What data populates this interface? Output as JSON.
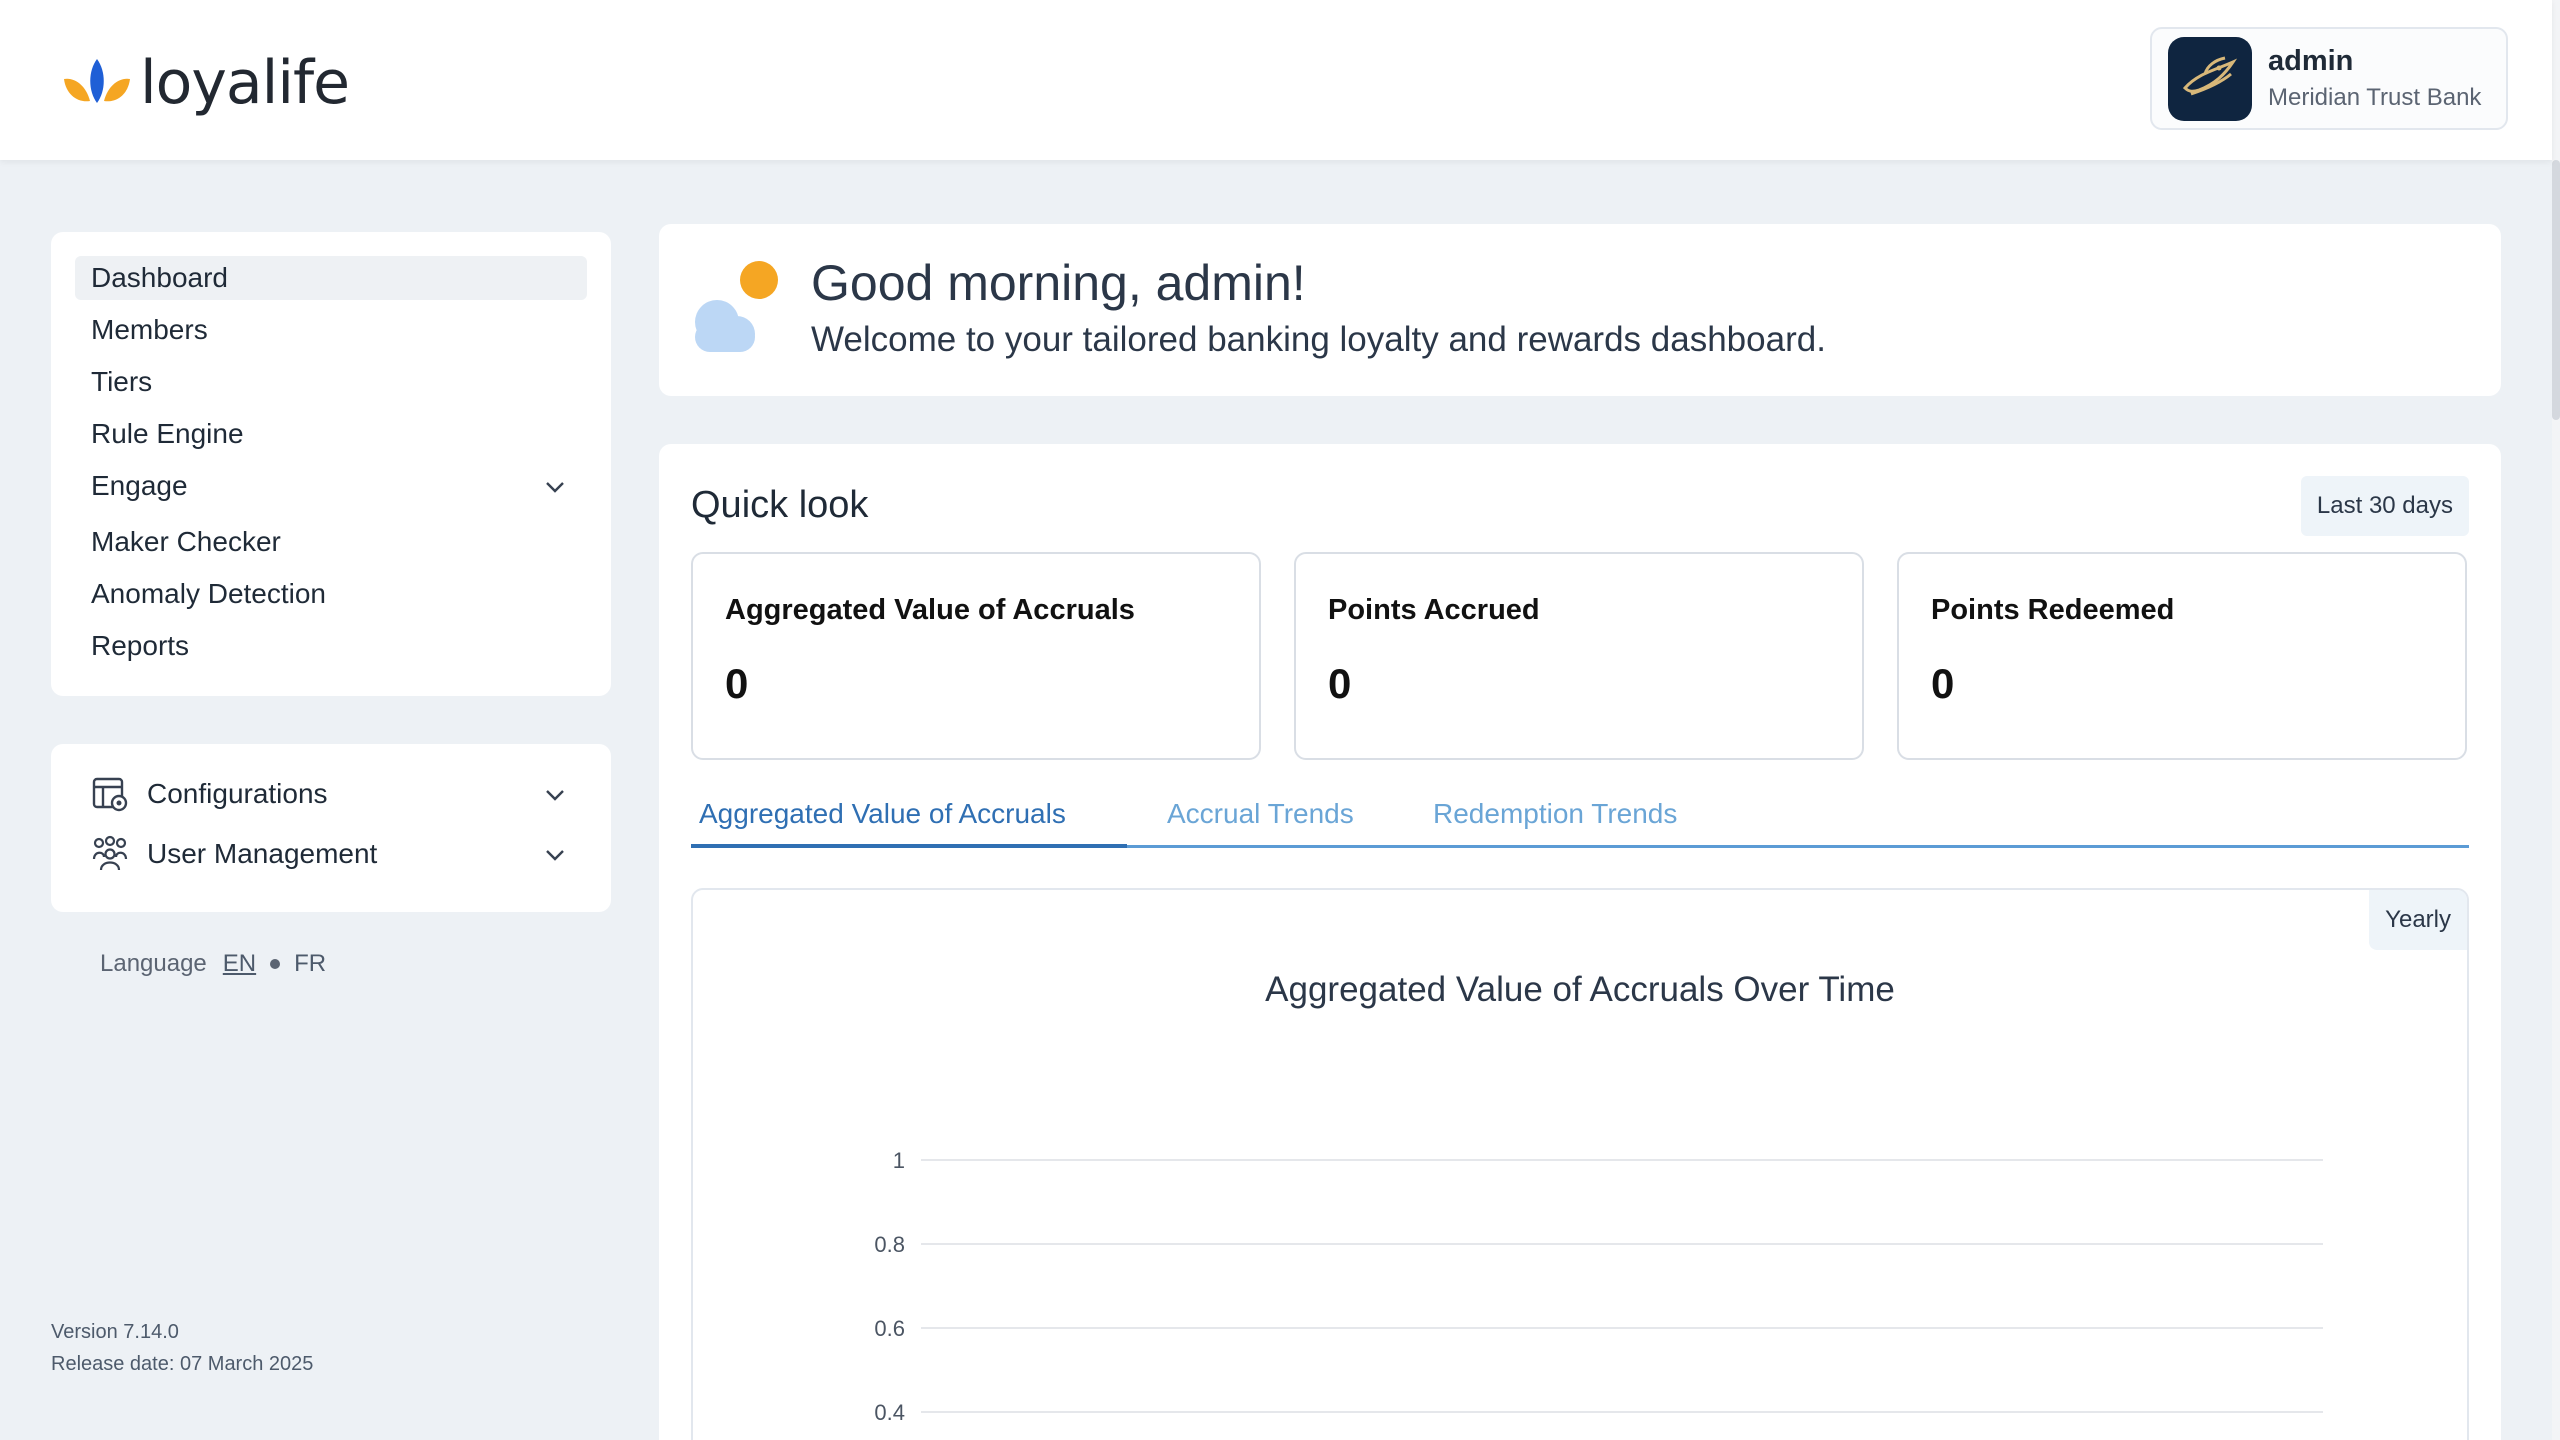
{
  "brand": {
    "name": "loyalife",
    "colors": {
      "leaf_left": "#f5a623",
      "leaf_center": "#1f5fd6",
      "leaf_right": "#f5a623"
    }
  },
  "profile": {
    "name": "admin",
    "org": "Meridian Trust Bank",
    "avatar_icon": "bird-logo-icon"
  },
  "sidebar": {
    "items": [
      {
        "label": "Dashboard",
        "active": true
      },
      {
        "label": "Members"
      },
      {
        "label": "Tiers"
      },
      {
        "label": "Rule Engine"
      },
      {
        "label": "Engage",
        "expandable": true
      },
      {
        "label": "Maker Checker"
      },
      {
        "label": "Anomaly Detection"
      },
      {
        "label": "Reports"
      }
    ],
    "config": [
      {
        "label": "Configurations",
        "icon": "settings-table-icon"
      },
      {
        "label": "User Management",
        "icon": "users-group-icon"
      }
    ],
    "language": {
      "label": "Language",
      "options": [
        "EN",
        "FR"
      ],
      "selected": "EN"
    },
    "version": "Version 7.14.0",
    "release": "Release date: 07 March 2025"
  },
  "greeting": {
    "title": "Good morning, admin!",
    "subtitle": "Welcome to your tailored banking loyalty and rewards dashboard.",
    "icon": "sun-cloud-icon"
  },
  "quick_look": {
    "title": "Quick look",
    "range": "Last 30 days",
    "stats": [
      {
        "label": "Aggregated Value of Accruals",
        "value": "0"
      },
      {
        "label": "Points Accrued",
        "value": "0"
      },
      {
        "label": "Points Redeemed",
        "value": "0"
      }
    ],
    "tabs": [
      {
        "label": "Aggregated Value of Accruals",
        "active": true
      },
      {
        "label": "Accrual Trends"
      },
      {
        "label": "Redemption Trends"
      }
    ],
    "period": "Yearly"
  },
  "chart_data": {
    "type": "line",
    "title": "Aggregated Value of Accruals Over Time",
    "yticks": [
      "1",
      "0.8",
      "0.6",
      "0.4"
    ],
    "ylim": [
      0,
      1
    ],
    "grid": true,
    "series": []
  }
}
